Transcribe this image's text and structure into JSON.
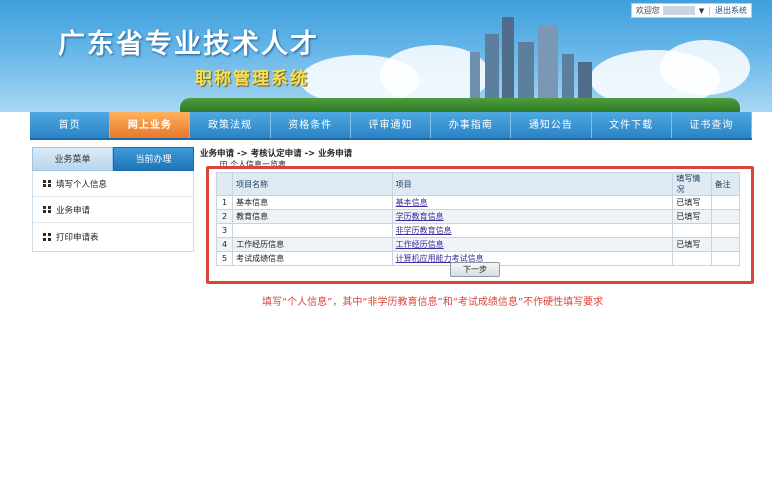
{
  "header": {
    "site_title": "广东省专业技术人才",
    "sub_title": "职称管理系统",
    "user": {
      "welcome": "欢迎您",
      "logout": "退出系统"
    }
  },
  "nav": {
    "items": [
      "首页",
      "网上业务",
      "政策法规",
      "资格条件",
      "评审通知",
      "办事指南",
      "通知公告",
      "文件下载",
      "证书查询"
    ],
    "active_index": 1
  },
  "sidebar": {
    "tabs": [
      "业务菜单",
      "当前办理"
    ],
    "active_tab": 1,
    "items": [
      "填写个人信息",
      "业务申请",
      "打印申请表"
    ]
  },
  "breadcrumb": "业务申请 -> 考核认定申请 -> 业务申请",
  "tree_node": "个人信息一览表",
  "table": {
    "headers": [
      "",
      "项目名称",
      "项目",
      "填写情况",
      "备注"
    ],
    "rows": [
      {
        "no": "1",
        "name": "基本信息",
        "item": "基本信息",
        "status": "已填写",
        "remark": ""
      },
      {
        "no": "2",
        "name": "教育信息",
        "item": "学历教育信息",
        "status": "已填写",
        "remark": ""
      },
      {
        "no": "3",
        "name": "",
        "item": "非学历教育信息",
        "status": "",
        "remark": ""
      },
      {
        "no": "4",
        "name": "工作经历信息",
        "item": "工作经历信息",
        "status": "已填写",
        "remark": ""
      },
      {
        "no": "5",
        "name": "考试成绩信息",
        "item": "计算机应用能力考试信息",
        "status": "",
        "remark": ""
      }
    ]
  },
  "next_button": "下一步",
  "note": "填写“个人信息”，其中“非学历教育信息”和“考试成绩信息”不作硬性填写要求",
  "colors": {
    "nav_blue": "#2a83c6",
    "active_orange": "#e8782a",
    "highlight_red": "#d9443a"
  }
}
